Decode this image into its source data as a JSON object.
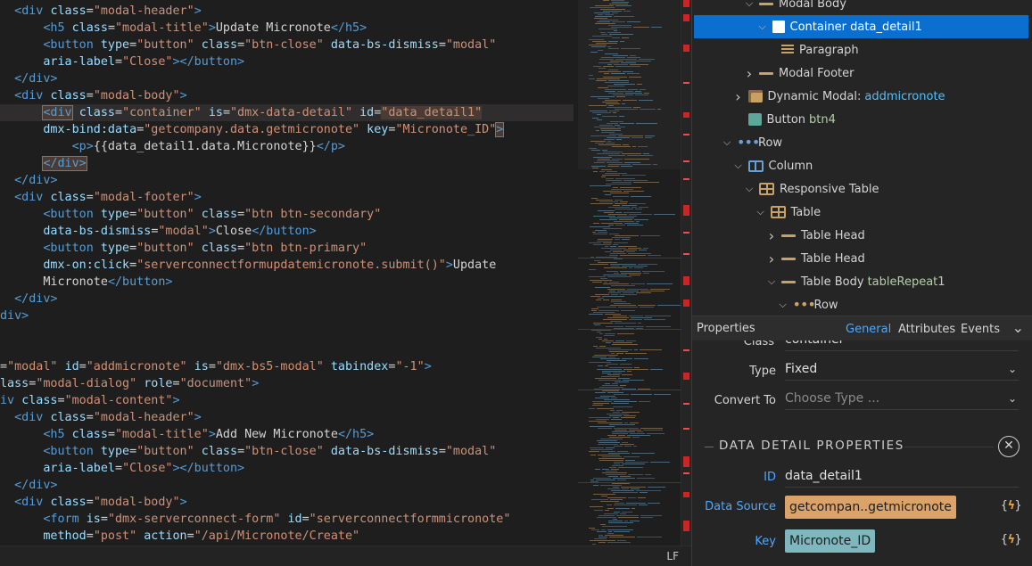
{
  "editor": {
    "lines": [
      [
        [
          "t",
          "  <"
        ],
        [
          "t",
          "div"
        ],
        [
          "x",
          " "
        ],
        [
          "a",
          "class"
        ],
        [
          "x",
          "="
        ],
        [
          "s",
          "\"modal-header\""
        ],
        [
          "t",
          ">"
        ]
      ],
      [
        [
          "x",
          "      "
        ],
        [
          "t",
          "<h5"
        ],
        [
          "x",
          " "
        ],
        [
          "a",
          "class"
        ],
        [
          "x",
          "="
        ],
        [
          "s",
          "\"modal-title\""
        ],
        [
          "t",
          ">"
        ],
        [
          "x",
          "Update Micronote"
        ],
        [
          "t",
          "</h5>"
        ]
      ],
      [
        [
          "x",
          "      "
        ],
        [
          "t",
          "<button"
        ],
        [
          "x",
          " "
        ],
        [
          "a",
          "type"
        ],
        [
          "x",
          "="
        ],
        [
          "s",
          "\"button\""
        ],
        [
          "x",
          " "
        ],
        [
          "a",
          "class"
        ],
        [
          "x",
          "="
        ],
        [
          "s",
          "\"btn-close\""
        ],
        [
          "x",
          " "
        ],
        [
          "a",
          "data-bs-dismiss"
        ],
        [
          "x",
          "="
        ],
        [
          "s",
          "\"modal\""
        ]
      ],
      [
        [
          "x",
          "      "
        ],
        [
          "a",
          "aria-label"
        ],
        [
          "x",
          "="
        ],
        [
          "s",
          "\"Close\""
        ],
        [
          "t",
          "></button>"
        ]
      ],
      [
        [
          "x",
          "  "
        ],
        [
          "t",
          "</div>"
        ]
      ],
      [
        [
          "x",
          "  "
        ],
        [
          "t",
          "<div"
        ],
        [
          "x",
          " "
        ],
        [
          "a",
          "class"
        ],
        [
          "x",
          "="
        ],
        [
          "s",
          "\"modal-body\""
        ],
        [
          "t",
          ">"
        ]
      ],
      [
        [
          "x",
          "      "
        ],
        [
          "t",
          "<div"
        ],
        [
          "x",
          " "
        ],
        [
          "a",
          "class"
        ],
        [
          "x",
          "="
        ],
        [
          "s",
          "\"container\""
        ],
        [
          "x",
          " "
        ],
        [
          "a",
          "is"
        ],
        [
          "x",
          "="
        ],
        [
          "s",
          "\"dmx-data-detail\""
        ],
        [
          "x",
          " "
        ],
        [
          "a",
          "id"
        ],
        [
          "x",
          "="
        ],
        [
          "s",
          "\"data_detail1\""
        ]
      ],
      [
        [
          "x",
          "      "
        ],
        [
          "a",
          "dmx-bind:data"
        ],
        [
          "x",
          "="
        ],
        [
          "s",
          "\"getcompany.data.getmicronote\""
        ],
        [
          "x",
          " "
        ],
        [
          "a",
          "key"
        ],
        [
          "x",
          "="
        ],
        [
          "s",
          "\"Micronote_ID\""
        ],
        [
          "t",
          ">"
        ]
      ],
      [
        [
          "x",
          "          "
        ],
        [
          "t",
          "<p>"
        ],
        [
          "x",
          "{{data_detail1.data.Micronote}}"
        ],
        [
          "t",
          "</p>"
        ]
      ],
      [
        [
          "x",
          "      "
        ],
        [
          "t",
          "</div>"
        ]
      ],
      [
        [
          "x",
          "  "
        ],
        [
          "t",
          "</div>"
        ]
      ],
      [
        [
          "x",
          "  "
        ],
        [
          "t",
          "<div"
        ],
        [
          "x",
          " "
        ],
        [
          "a",
          "class"
        ],
        [
          "x",
          "="
        ],
        [
          "s",
          "\"modal-footer\""
        ],
        [
          "t",
          ">"
        ]
      ],
      [
        [
          "x",
          "      "
        ],
        [
          "t",
          "<button"
        ],
        [
          "x",
          " "
        ],
        [
          "a",
          "type"
        ],
        [
          "x",
          "="
        ],
        [
          "s",
          "\"button\""
        ],
        [
          "x",
          " "
        ],
        [
          "a",
          "class"
        ],
        [
          "x",
          "="
        ],
        [
          "s",
          "\"btn btn-secondary\""
        ]
      ],
      [
        [
          "x",
          "      "
        ],
        [
          "a",
          "data-bs-dismiss"
        ],
        [
          "x",
          "="
        ],
        [
          "s",
          "\"modal\""
        ],
        [
          "t",
          ">"
        ],
        [
          "x",
          "Close"
        ],
        [
          "t",
          "</button>"
        ]
      ],
      [
        [
          "x",
          "      "
        ],
        [
          "t",
          "<button"
        ],
        [
          "x",
          " "
        ],
        [
          "a",
          "type"
        ],
        [
          "x",
          "="
        ],
        [
          "s",
          "\"button\""
        ],
        [
          "x",
          " "
        ],
        [
          "a",
          "class"
        ],
        [
          "x",
          "="
        ],
        [
          "s",
          "\"btn btn-primary\""
        ]
      ],
      [
        [
          "x",
          "      "
        ],
        [
          "a",
          "dmx-on:click"
        ],
        [
          "x",
          "="
        ],
        [
          "s",
          "\"serverconnectformupdatemicronote.submit()\""
        ],
        [
          "t",
          ">"
        ],
        [
          "x",
          "Update"
        ]
      ],
      [
        [
          "x",
          "      Micronote"
        ],
        [
          "t",
          "</button>"
        ]
      ],
      [
        [
          "x",
          "  "
        ],
        [
          "t",
          "</div>"
        ]
      ],
      [
        [
          "t",
          "div>"
        ]
      ],
      [],
      [],
      [
        [
          "x",
          "="
        ],
        [
          "s",
          "\"modal\""
        ],
        [
          "x",
          " "
        ],
        [
          "a",
          "id"
        ],
        [
          "x",
          "="
        ],
        [
          "s",
          "\"addmicronote\""
        ],
        [
          "x",
          " "
        ],
        [
          "a",
          "is"
        ],
        [
          "x",
          "="
        ],
        [
          "s",
          "\"dmx-bs5-modal\""
        ],
        [
          "x",
          " "
        ],
        [
          "a",
          "tabindex"
        ],
        [
          "x",
          "="
        ],
        [
          "s",
          "\"-1\""
        ],
        [
          "t",
          ">"
        ]
      ],
      [
        [
          "a",
          "lass"
        ],
        [
          "x",
          "="
        ],
        [
          "s",
          "\"modal-dialog\""
        ],
        [
          "x",
          " "
        ],
        [
          "a",
          "role"
        ],
        [
          "x",
          "="
        ],
        [
          "s",
          "\"document\""
        ],
        [
          "t",
          ">"
        ]
      ],
      [
        [
          "t",
          "iv"
        ],
        [
          "x",
          " "
        ],
        [
          "a",
          "class"
        ],
        [
          "x",
          "="
        ],
        [
          "s",
          "\"modal-content\""
        ],
        [
          "t",
          ">"
        ]
      ],
      [
        [
          "x",
          "  "
        ],
        [
          "t",
          "<div"
        ],
        [
          "x",
          " "
        ],
        [
          "a",
          "class"
        ],
        [
          "x",
          "="
        ],
        [
          "s",
          "\"modal-header\""
        ],
        [
          "t",
          ">"
        ]
      ],
      [
        [
          "x",
          "      "
        ],
        [
          "t",
          "<h5"
        ],
        [
          "x",
          " "
        ],
        [
          "a",
          "class"
        ],
        [
          "x",
          "="
        ],
        [
          "s",
          "\"modal-title\""
        ],
        [
          "t",
          ">"
        ],
        [
          "x",
          "Add New Micronote"
        ],
        [
          "t",
          "</h5>"
        ]
      ],
      [
        [
          "x",
          "      "
        ],
        [
          "t",
          "<button"
        ],
        [
          "x",
          " "
        ],
        [
          "a",
          "type"
        ],
        [
          "x",
          "="
        ],
        [
          "s",
          "\"button\""
        ],
        [
          "x",
          " "
        ],
        [
          "a",
          "class"
        ],
        [
          "x",
          "="
        ],
        [
          "s",
          "\"btn-close\""
        ],
        [
          "x",
          " "
        ],
        [
          "a",
          "data-bs-dismiss"
        ],
        [
          "x",
          "="
        ],
        [
          "s",
          "\"modal\""
        ]
      ],
      [
        [
          "x",
          "      "
        ],
        [
          "a",
          "aria-label"
        ],
        [
          "x",
          "="
        ],
        [
          "s",
          "\"Close\""
        ],
        [
          "t",
          "></button>"
        ]
      ],
      [
        [
          "x",
          "  "
        ],
        [
          "t",
          "</div>"
        ]
      ],
      [
        [
          "x",
          "  "
        ],
        [
          "t",
          "<div"
        ],
        [
          "x",
          " "
        ],
        [
          "a",
          "class"
        ],
        [
          "x",
          "="
        ],
        [
          "s",
          "\"modal-body\""
        ],
        [
          "t",
          ">"
        ]
      ],
      [
        [
          "x",
          "      "
        ],
        [
          "t",
          "<form"
        ],
        [
          "x",
          " "
        ],
        [
          "a",
          "is"
        ],
        [
          "x",
          "="
        ],
        [
          "s",
          "\"dmx-serverconnect-form\""
        ],
        [
          "x",
          " "
        ],
        [
          "a",
          "id"
        ],
        [
          "x",
          "="
        ],
        [
          "s",
          "\"serverconnectformmicronote\""
        ]
      ],
      [
        [
          "x",
          "      "
        ],
        [
          "a",
          "method"
        ],
        [
          "x",
          "="
        ],
        [
          "s",
          "\"post\""
        ],
        [
          "x",
          " "
        ],
        [
          "a",
          "action"
        ],
        [
          "x",
          "="
        ],
        [
          "s",
          "\"/api/Micronote/Create\""
        ]
      ]
    ],
    "highlighted_line": 6
  },
  "statusbar": {
    "line_ending": "LF"
  },
  "tree": [
    {
      "indent": 6,
      "chevron": "open",
      "icon": "bar",
      "label": "Modal Body",
      "sub": ""
    },
    {
      "indent": 7,
      "chevron": "open",
      "icon": "white",
      "label": "Container data_detail1",
      "sub": "",
      "selected": true
    },
    {
      "indent": 8,
      "chevron": "",
      "icon": "para",
      "label": "Paragraph",
      "sub": ""
    },
    {
      "indent": 6,
      "chevron": "closed",
      "icon": "bar",
      "label": "Modal Footer",
      "sub": ""
    },
    {
      "indent": 5,
      "chevron": "closed",
      "icon": "modal",
      "label": "Dynamic Modal:",
      "sub": "addmicronote",
      "subColor": "blue"
    },
    {
      "indent": 5,
      "chevron": "",
      "icon": "btn",
      "label": "Button",
      "sub": "btn4",
      "subColor": "green"
    },
    {
      "indent": 4,
      "chevron": "open",
      "icon": "dots",
      "label": "Row",
      "sub": ""
    },
    {
      "indent": 5,
      "chevron": "open",
      "icon": "col",
      "label": "Column",
      "sub": ""
    },
    {
      "indent": 6,
      "chevron": "open",
      "icon": "table",
      "label": "Responsive Table",
      "sub": ""
    },
    {
      "indent": 7,
      "chevron": "open",
      "icon": "table",
      "label": "Table",
      "sub": ""
    },
    {
      "indent": 8,
      "chevron": "closed",
      "icon": "bar",
      "label": "Table Head",
      "sub": ""
    },
    {
      "indent": 8,
      "chevron": "closed",
      "icon": "bar",
      "label": "Table Head",
      "sub": ""
    },
    {
      "indent": 8,
      "chevron": "open",
      "icon": "bar",
      "label": "Table Body",
      "sub": "tableRepeat1",
      "subColor": "green"
    },
    {
      "indent": 9,
      "chevron": "open",
      "icon": "dotswarm",
      "label": "Row",
      "sub": ""
    }
  ],
  "properties": {
    "title": "Properties",
    "tabs": [
      "General",
      "Attributes",
      "Events"
    ],
    "active_tab": "General",
    "partial_label": "Class",
    "partial_value": "container",
    "type_label": "Type",
    "type_value": "Fixed",
    "convert_label": "Convert To",
    "convert_placeholder": "Choose Type ...",
    "section_title": "DATA DETAIL PROPERTIES",
    "id_label": "ID",
    "id_value": "data_detail1",
    "datasource_label": "Data Source",
    "datasource_value": "getcompan..getmicronote",
    "key_label": "Key",
    "key_value": "Micronote_ID",
    "bind_glyph_open": "{",
    "bind_glyph_bolt": "ϟ",
    "bind_glyph_close": "}"
  },
  "colors": {
    "accent": "#0a6fcf",
    "tag": "#569cd6",
    "attr": "#9cdcfe",
    "string": "#ce9178",
    "chip_orange": "#dba36a",
    "chip_teal": "#7fb7bf",
    "marker_red": "#c62828"
  },
  "icons": {
    "chevron_open": "chevron-down-icon",
    "chevron_closed": "chevron-right-icon",
    "collapse": "chevron-down-icon",
    "close": "close-circle-icon",
    "bind": "dynamic-bind-icon"
  }
}
